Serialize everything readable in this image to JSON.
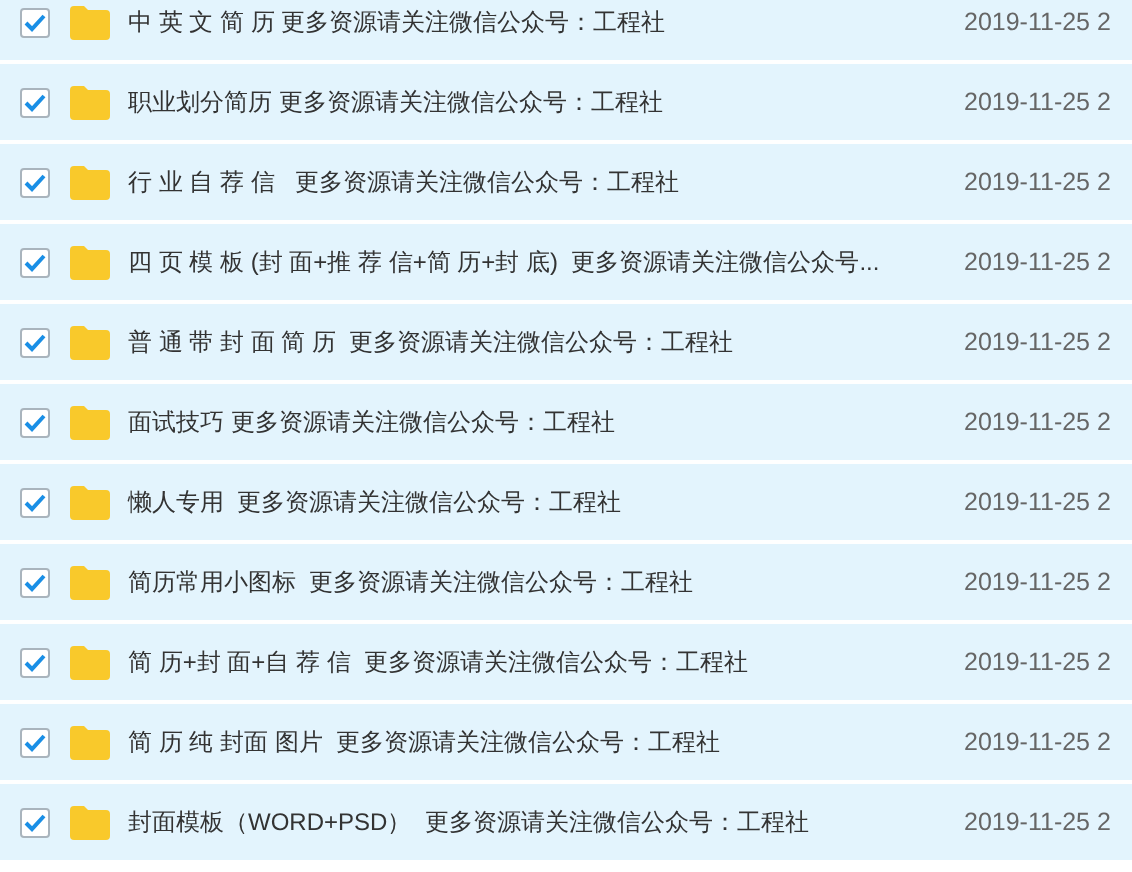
{
  "files": [
    {
      "name": "中 英 文 简 历 更多资源请关注微信公众号：工程社",
      "date": "2019-11-25 2",
      "checked": true
    },
    {
      "name": "职业划分简历 更多资源请关注微信公众号：工程社",
      "date": "2019-11-25 2",
      "checked": true
    },
    {
      "name": "行 业 自 荐 信   更多资源请关注微信公众号：工程社",
      "date": "2019-11-25 2",
      "checked": true
    },
    {
      "name": "四 页 模 板 (封 面+推 荐 信+简 历+封 底)  更多资源请关注微信公众号...",
      "date": "2019-11-25 2",
      "checked": true
    },
    {
      "name": "普 通 带 封 面 简 历  更多资源请关注微信公众号：工程社",
      "date": "2019-11-25 2",
      "checked": true
    },
    {
      "name": "面试技巧 更多资源请关注微信公众号：工程社",
      "date": "2019-11-25 2",
      "checked": true
    },
    {
      "name": "懒人专用  更多资源请关注微信公众号：工程社",
      "date": "2019-11-25 2",
      "checked": true
    },
    {
      "name": "简历常用小图标  更多资源请关注微信公众号：工程社",
      "date": "2019-11-25 2",
      "checked": true
    },
    {
      "name": "简 历+封 面+自 荐 信  更多资源请关注微信公众号：工程社",
      "date": "2019-11-25 2",
      "checked": true
    },
    {
      "name": "简 历 纯 封面 图片  更多资源请关注微信公众号：工程社",
      "date": "2019-11-25 2",
      "checked": true
    },
    {
      "name": "封面模板（WORD+PSD）  更多资源请关注微信公众号：工程社",
      "date": "2019-11-25 2",
      "checked": true
    }
  ]
}
